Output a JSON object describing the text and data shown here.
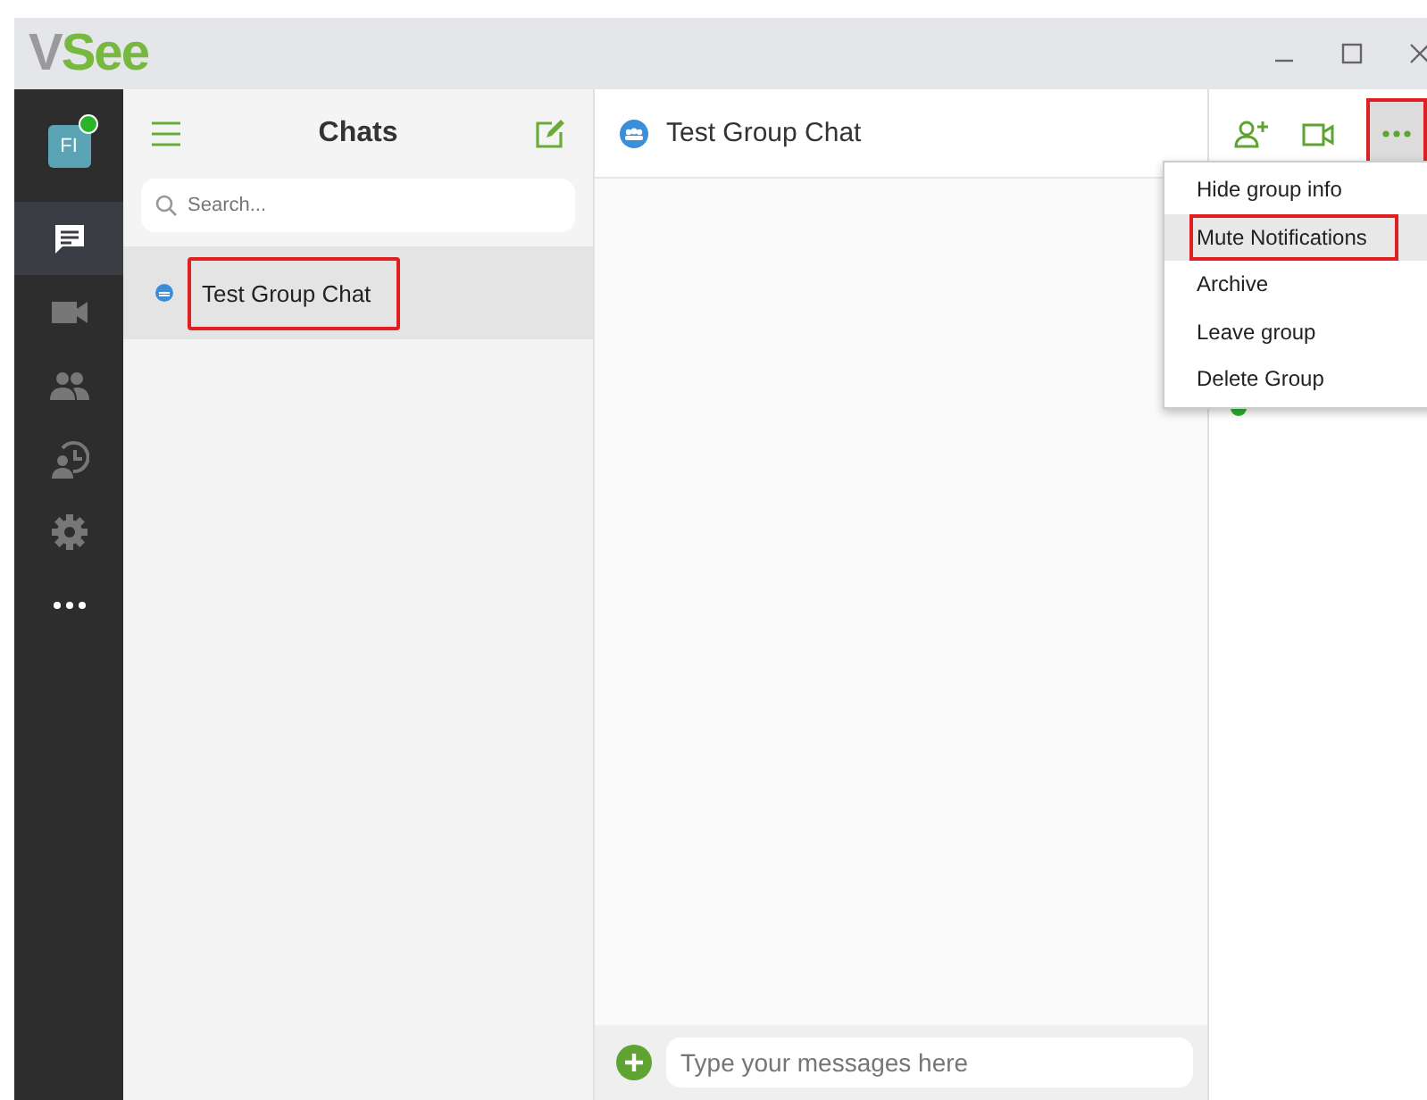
{
  "app": {
    "logo_prefix": "V",
    "logo_suffix": "See"
  },
  "profile": {
    "initials": "FI",
    "online": true
  },
  "nav": [
    {
      "kind": "chat",
      "selected": true
    },
    {
      "kind": "video",
      "selected": false
    },
    {
      "kind": "contacts",
      "selected": false
    },
    {
      "kind": "history",
      "selected": false
    },
    {
      "kind": "settings",
      "selected": false
    },
    {
      "kind": "more",
      "selected": false
    }
  ],
  "chats_panel": {
    "title": "Chats",
    "search": {
      "placeholder": "Search..."
    },
    "items": [
      {
        "name": "Test Group Chat",
        "selected": true,
        "highlighted": true
      }
    ]
  },
  "conversation": {
    "title": "Test Group Chat",
    "more_highlighted": true,
    "composer": {
      "placeholder": "Type your messages here"
    }
  },
  "menu": {
    "items": [
      {
        "label": "Hide group info",
        "selected": false,
        "highlighted": false
      },
      {
        "label": "Mute Notifications",
        "selected": true,
        "highlighted": true
      },
      {
        "label": "Archive",
        "selected": false,
        "highlighted": false
      },
      {
        "label": "Leave group",
        "selected": false,
        "highlighted": false
      },
      {
        "label": "Delete Group",
        "selected": false,
        "highlighted": false
      }
    ]
  },
  "members": [
    {
      "online": true
    }
  ]
}
